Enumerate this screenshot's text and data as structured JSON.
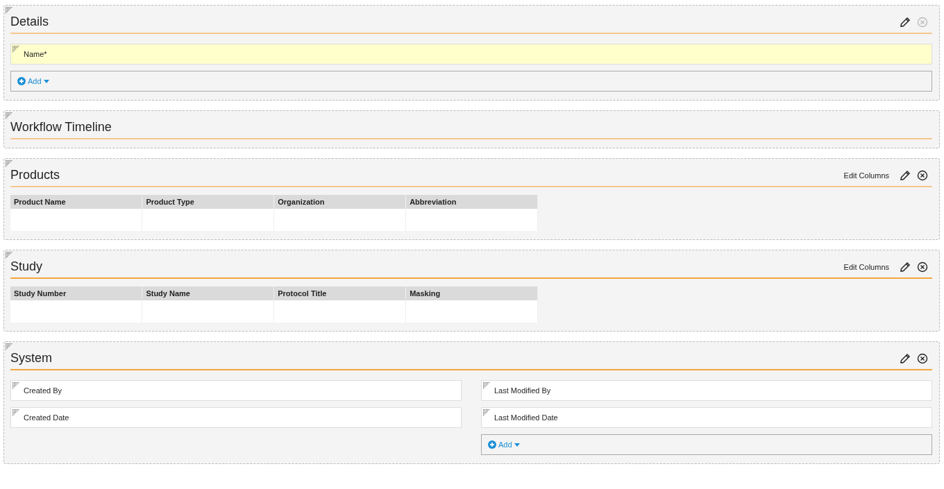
{
  "sections": [
    {
      "kind": "form",
      "title": "Details",
      "emphasized": false,
      "editable": true,
      "close_disabled": true,
      "fields": [
        {
          "label": "Name*",
          "required": true
        }
      ],
      "add_label": "Add"
    },
    {
      "kind": "empty",
      "title": "Workflow Timeline",
      "emphasized": false,
      "editable": false
    },
    {
      "kind": "table",
      "title": "Products",
      "emphasized": false,
      "editable": true,
      "close_disabled": false,
      "edit_columns": "Edit Columns",
      "columns": [
        "Product Name",
        "Product Type",
        "Organization",
        "Abbreviation"
      ]
    },
    {
      "kind": "table",
      "title": "Study",
      "emphasized": true,
      "editable": true,
      "close_disabled": false,
      "edit_columns": "Edit Columns",
      "columns": [
        "Study Number",
        "Study Name",
        "Protocol Title",
        "Masking"
      ]
    },
    {
      "kind": "split",
      "title": "System",
      "emphasized": true,
      "editable": true,
      "close_disabled": false,
      "panes": [
        {
          "fields": [
            {
              "label": "Created By",
              "required": false
            },
            {
              "label": "Created Date",
              "required": false
            }
          ]
        },
        {
          "fields": [
            {
              "label": "Last Modified By",
              "required": false
            },
            {
              "label": "Last Modified Date",
              "required": false
            }
          ],
          "add_label": "Add"
        }
      ]
    }
  ]
}
